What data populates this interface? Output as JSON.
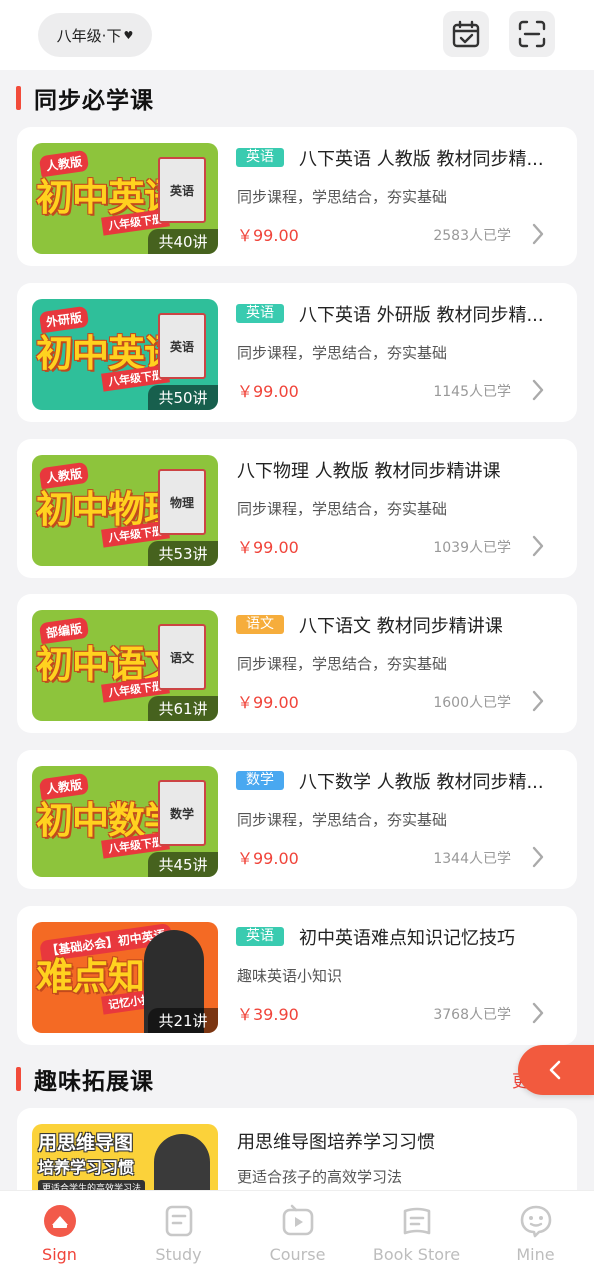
{
  "header": {
    "grade_selector": "八年级·下",
    "grade_caret": "♥",
    "calendar_icon": "calendar-check-icon",
    "scan_icon": "scan-icon"
  },
  "sections": {
    "required": "同步必学课",
    "extended": "趣味拓展课",
    "more_label": "更"
  },
  "courses": [
    {
      "tag": "英语",
      "tag_color": "#39cbb0",
      "title": "八下英语 人教版 教材同步精...",
      "subtitle": "同步课程，学思结合，夯实基础",
      "price": "￥99.00",
      "learners": "2583人已学",
      "thumb": {
        "badge": "人教版",
        "big": "初中英语",
        "ribbon": "八年级下册",
        "book": "英语",
        "count": "共40讲",
        "bg": "#8dc43c"
      }
    },
    {
      "tag": "英语",
      "tag_color": "#39cbb0",
      "title": "八下英语 外研版 教材同步精...",
      "subtitle": "同步课程，学思结合，夯实基础",
      "price": "￥99.00",
      "learners": "1145人已学",
      "thumb": {
        "badge": "外研版",
        "big": "初中英语",
        "ribbon": "八年级下册",
        "book": "英语",
        "count": "共50讲",
        "bg": "#2fbf9a"
      }
    },
    {
      "tag": "",
      "tag_color": "",
      "title": "八下物理 人教版 教材同步精讲课",
      "subtitle": "同步课程，学思结合，夯实基础",
      "price": "￥99.00",
      "learners": "1039人已学",
      "thumb": {
        "badge": "人教版",
        "big": "初中物理",
        "ribbon": "八年级下册",
        "book": "物理",
        "count": "共53讲",
        "bg": "#8dc43c"
      }
    },
    {
      "tag": "语文",
      "tag_color": "#f6ad3c",
      "title": "八下语文 教材同步精讲课",
      "subtitle": "同步课程，学思结合，夯实基础",
      "price": "￥99.00",
      "learners": "1600人已学",
      "thumb": {
        "badge": "部编版",
        "big": "初中语文",
        "ribbon": "八年级下册",
        "book": "语文",
        "count": "共61讲",
        "bg": "#8dc43c"
      }
    },
    {
      "tag": "数学",
      "tag_color": "#49a8f0",
      "title": "八下数学 人教版 教材同步精...",
      "subtitle": "同步课程，学思结合，夯实基础",
      "price": "￥99.00",
      "learners": "1344人已学",
      "thumb": {
        "badge": "人教版",
        "big": "初中数学",
        "ribbon": "八年级下册",
        "book": "数学",
        "count": "共45讲",
        "bg": "#8dc43c"
      }
    },
    {
      "tag": "英语",
      "tag_color": "#39cbb0",
      "title": "初中英语难点知识记忆技巧",
      "subtitle": "趣味英语小知识",
      "price": "￥39.90",
      "learners": "3768人已学",
      "thumb": {
        "badge": "【基础必会】初中英语",
        "big": "难点知识",
        "ribbon": "记忆小技巧",
        "book": "",
        "count": "共21讲",
        "bg": "#f46a24"
      }
    }
  ],
  "extended_course": {
    "title": "用思维导图培养学习习惯",
    "subtitle": "更适合孩子的高效学习法",
    "thumb": {
      "line1": "用思维导图",
      "line2": "培养学习习惯",
      "line3": "更适合学生的高效学习法"
    }
  },
  "bottom_nav": [
    {
      "label": "Sign",
      "icon": "sign-home-icon",
      "active": true
    },
    {
      "label": "Study",
      "icon": "study-book-icon",
      "active": false
    },
    {
      "label": "Course",
      "icon": "course-play-icon",
      "active": false
    },
    {
      "label": "Book Store",
      "icon": "book-store-icon",
      "active": false
    },
    {
      "label": "Mine",
      "icon": "mine-face-icon",
      "active": false
    }
  ],
  "colors": {
    "accent": "#f0443a",
    "nav_inactive": "#bdbdbd"
  }
}
